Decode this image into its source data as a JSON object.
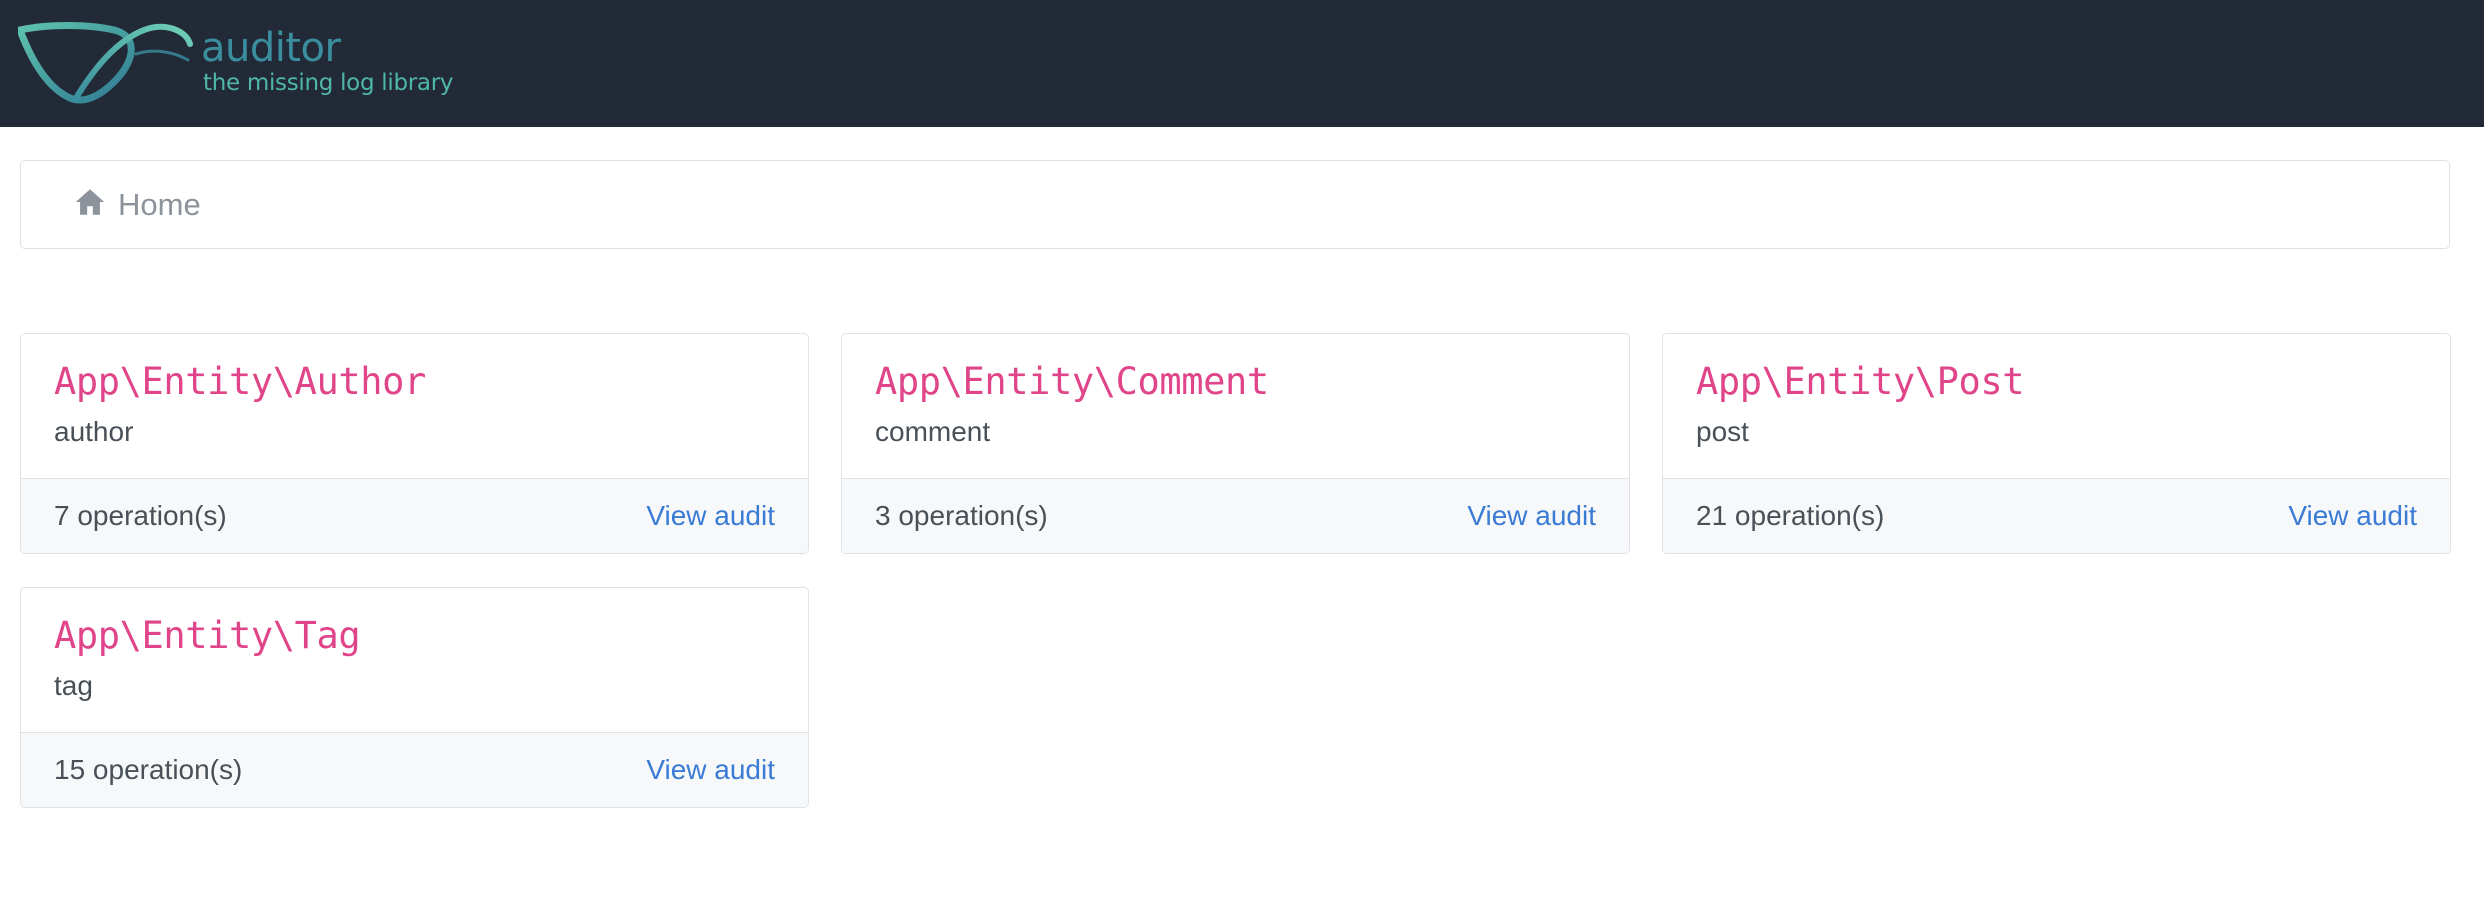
{
  "brand": {
    "name": "auditor",
    "tagline": "the missing log library",
    "colors": {
      "navbar": "#222a37",
      "name": "#3a8e9e",
      "tagline": "#4eb7a9"
    },
    "logo_icon": "auditor-swoosh-logo"
  },
  "breadcrumb": {
    "items": [
      {
        "icon": "home-icon",
        "label": "Home"
      }
    ]
  },
  "entities": [
    {
      "class_name": "App\\Entity\\Author",
      "table": "author",
      "operations": "7 operation(s)",
      "action_label": "View audit"
    },
    {
      "class_name": "App\\Entity\\Comment",
      "table": "comment",
      "operations": "3 operation(s)",
      "action_label": "View audit"
    },
    {
      "class_name": "App\\Entity\\Post",
      "table": "post",
      "operations": "21 operation(s)",
      "action_label": "View audit"
    },
    {
      "class_name": "App\\Entity\\Tag",
      "table": "tag",
      "operations": "15 operation(s)",
      "action_label": "View audit"
    }
  ],
  "colors": {
    "entity_class": "#e0458a",
    "link": "#3a7bd5",
    "muted_text": "#495057",
    "breadcrumb_text": "#8c939b"
  }
}
